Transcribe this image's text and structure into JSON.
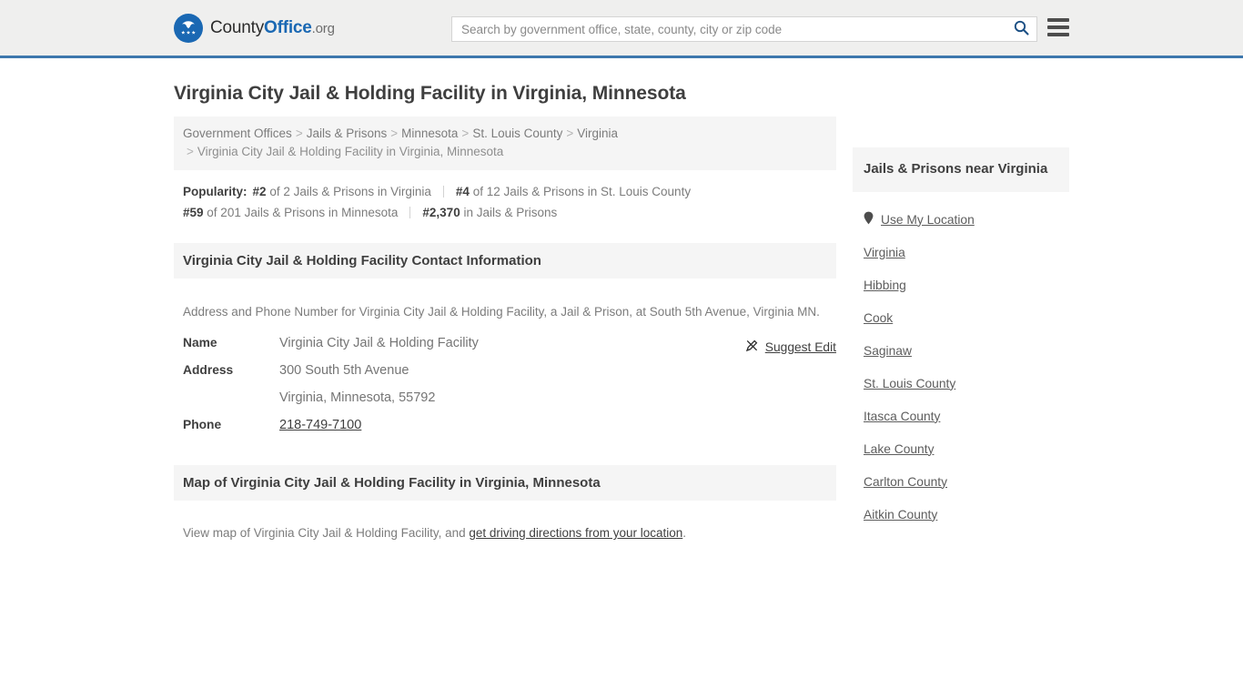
{
  "header": {
    "logo": {
      "part1": "County",
      "part2": "Office",
      "part3": ".org",
      "icon": "eagle-shield-logo-icon"
    },
    "search": {
      "placeholder": "Search by government office, state, county, city or zip code",
      "value": "",
      "button_icon": "search-icon"
    },
    "menu_icon": "hamburger-menu-icon",
    "accent_color": "#3d77ad"
  },
  "main": {
    "page_title": "Virginia City Jail & Holding Facility in Virginia, Minnesota",
    "breadcrumb": {
      "items": [
        "Government Offices",
        "Jails & Prisons",
        "Minnesota",
        "St. Louis County",
        "Virginia"
      ],
      "current": "Virginia City Jail & Holding Facility in Virginia, Minnesota",
      "separator": ">"
    },
    "popularity": {
      "label": "Popularity:",
      "items": [
        {
          "rank": "#2",
          "text": "of 2 Jails & Prisons in Virginia"
        },
        {
          "rank": "#4",
          "text": "of 12 Jails & Prisons in St. Louis County"
        },
        {
          "rank": "#59",
          "text": "of 201 Jails & Prisons in Minnesota"
        },
        {
          "rank": "#2,370",
          "text": "in Jails & Prisons"
        }
      ]
    },
    "contact_section": {
      "heading": "Virginia City Jail & Holding Facility Contact Information",
      "description": "Address and Phone Number for Virginia City Jail & Holding Facility, a Jail & Prison, at South 5th Avenue, Virginia MN.",
      "suggest_edit": {
        "label": "Suggest Edit",
        "icon": "edit-pencil-icon"
      },
      "rows": [
        {
          "key": "Name",
          "value": "Virginia City Jail & Holding Facility",
          "link": false
        },
        {
          "key": "Address",
          "value": "300 South 5th Avenue",
          "link": false
        },
        {
          "key": "",
          "value": "Virginia, Minnesota, 55792",
          "link": false
        },
        {
          "key": "Phone",
          "value": "218-749-7100",
          "link": true
        }
      ]
    },
    "map_section": {
      "heading": "Map of Virginia City Jail & Holding Facility in Virginia, Minnesota",
      "desc_before": "View map of Virginia City Jail & Holding Facility, and ",
      "desc_link": "get driving directions from your location",
      "desc_after": "."
    }
  },
  "sidebar": {
    "heading": "Jails & Prisons near Virginia",
    "use_my_location": {
      "label": "Use My Location",
      "icon": "map-pin-icon"
    },
    "links": [
      "Virginia",
      "Hibbing",
      "Cook",
      "Saginaw",
      "St. Louis County",
      "Itasca County",
      "Lake County",
      "Carlton County",
      "Aitkin County"
    ]
  }
}
